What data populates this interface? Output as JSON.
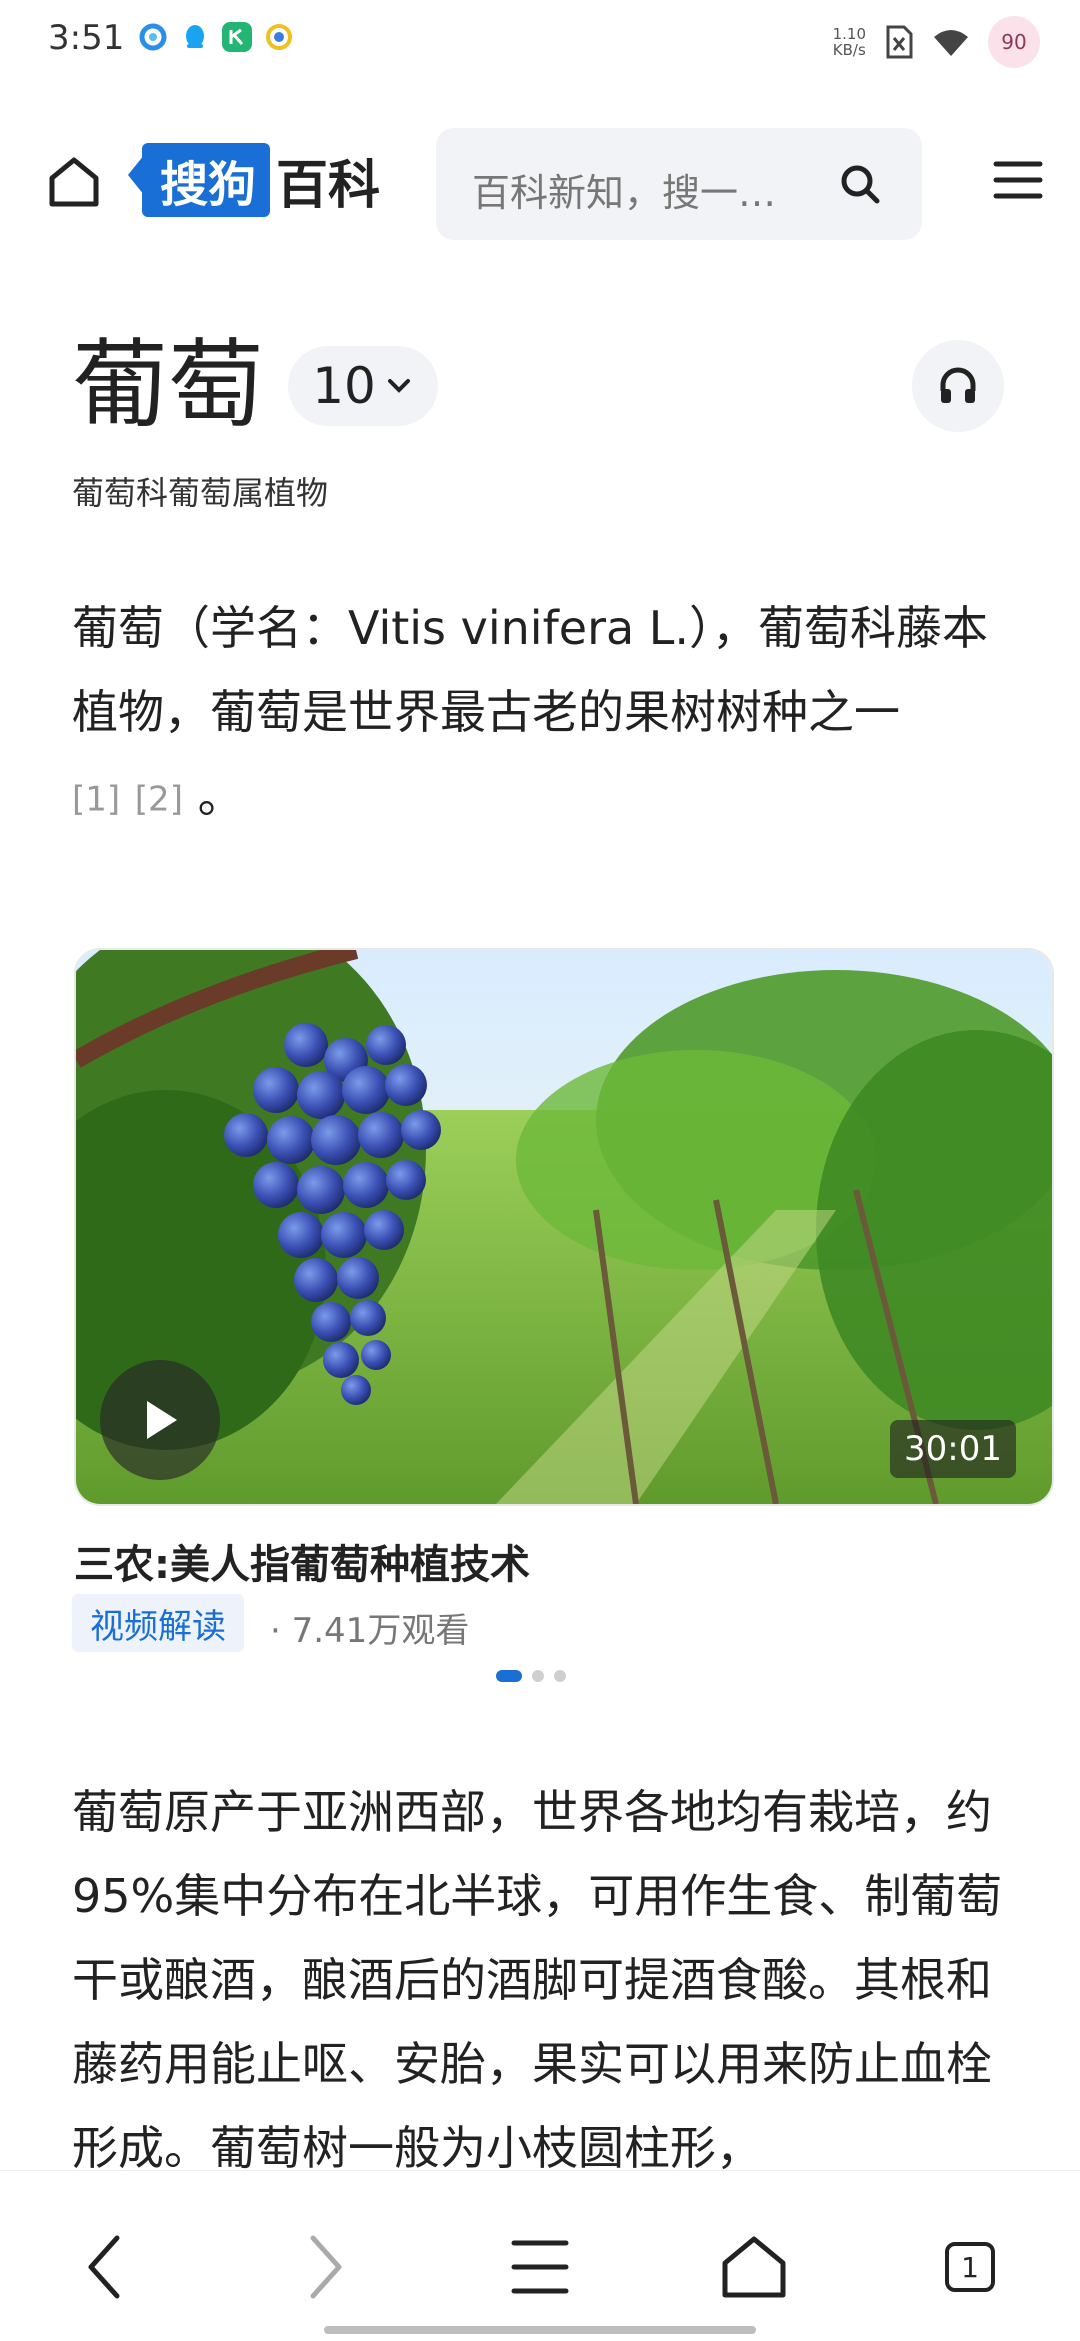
{
  "status_bar": {
    "time": "3:51",
    "net_speed_value": "1.10",
    "net_speed_unit": "KB/s",
    "battery": "90",
    "icons": [
      "browser-icon",
      "qq-icon",
      "app-icon",
      "chrome-like-icon",
      "sim-off-icon",
      "wifi-icon"
    ]
  },
  "header": {
    "logo_badge": "搜狗",
    "logo_text": "百科",
    "search_placeholder": "百科新知，搜一…",
    "accent_color": "#1a6fd6"
  },
  "entry": {
    "title": "葡萄",
    "version": "10",
    "subtitle": "葡萄科葡萄属植物",
    "intro_text": "葡萄（学名：Vitis vinifera L.），葡萄科藤本植物，葡萄是世界最古老的果树树种之一",
    "refs": [
      "[1]",
      "[2]"
    ],
    "intro_end": "。"
  },
  "video": {
    "duration": "30:01",
    "title": "三农:美人指葡萄种植技术",
    "tag": "视频解读",
    "views": "· 7.41万观看",
    "carousel_index": 1,
    "carousel_count": 3
  },
  "body": {
    "text": "葡萄原产于亚洲西部，世界各地均有栽培，约95%集中分布在北半球，可用作生食、制葡萄干或酿酒，酿酒后的酒脚可提酒食酸。其根和藤药用能止呕、安胎，果实可以用来防止血栓形成。葡萄树一般为小枝圆柱形，"
  },
  "bottom_nav": {
    "tab_count": "1"
  }
}
